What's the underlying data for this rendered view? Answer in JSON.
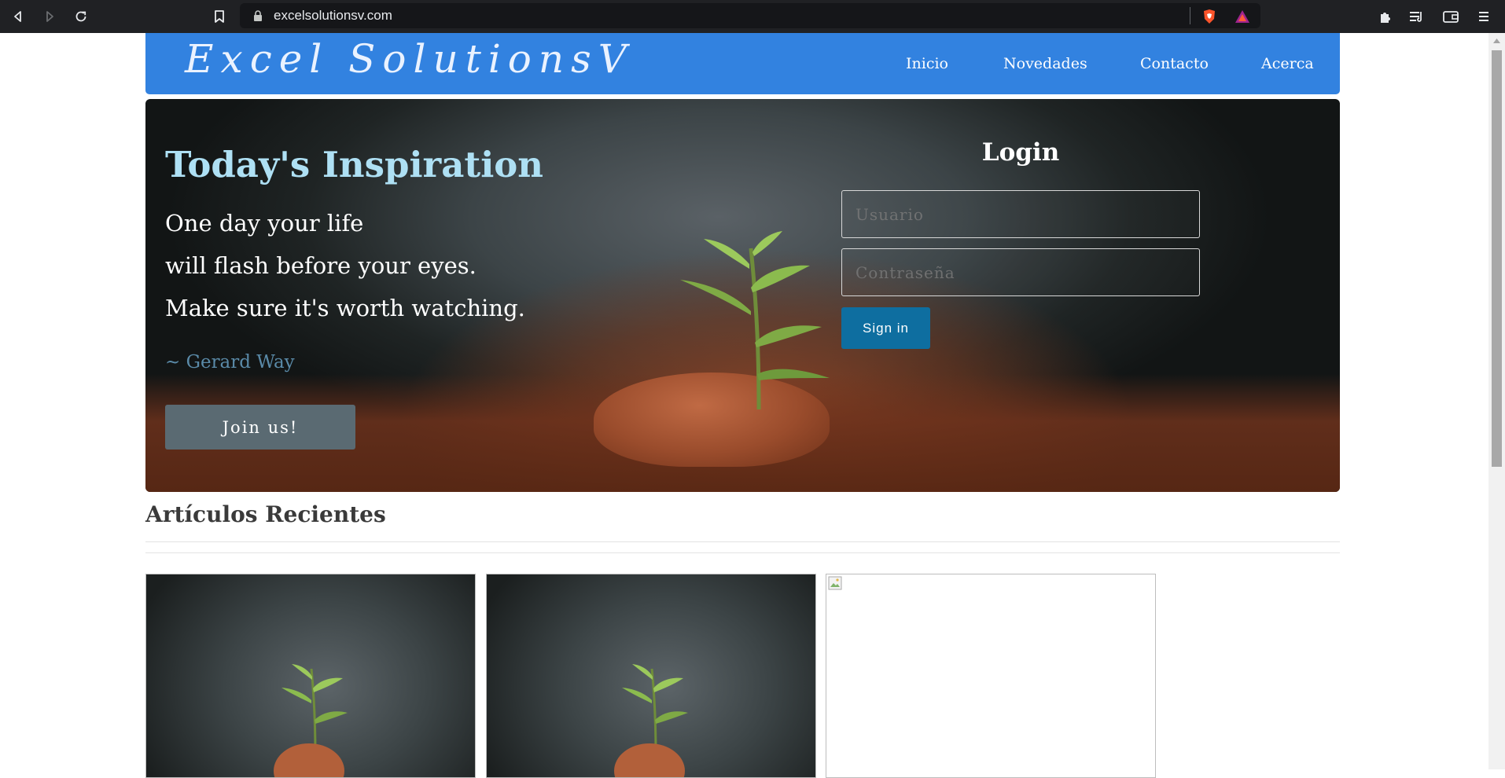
{
  "browser": {
    "url": "excelsolutionsv.com",
    "icons": [
      "back-icon",
      "forward-icon",
      "reload-icon",
      "bookmark-icon",
      "lock-icon",
      "brave-shield-icon",
      "brave-rewards-icon",
      "extensions-icon",
      "playlist-icon",
      "wallet-icon",
      "menu-icon"
    ]
  },
  "navbar": {
    "logo": "Excel SolutionsV",
    "links": [
      "Inicio",
      "Novedades",
      "Contacto",
      "Acerca"
    ]
  },
  "hero": {
    "title": "Today's Inspiration",
    "quote_lines": [
      "One day your life",
      "will flash before your eyes.",
      "Make sure it's worth watching."
    ],
    "author": "~ Gerard Way",
    "join_label": "Join us!"
  },
  "login": {
    "title": "Login",
    "username_placeholder": "Usuario",
    "password_placeholder": "Contraseña",
    "signin_label": "Sign in"
  },
  "recent": {
    "title": "Artículos Recientes"
  },
  "colors": {
    "navbar": "#3282e0",
    "hero_title": "#aee0f4",
    "signin": "#0e6ea0",
    "join": "#5a6a72"
  }
}
